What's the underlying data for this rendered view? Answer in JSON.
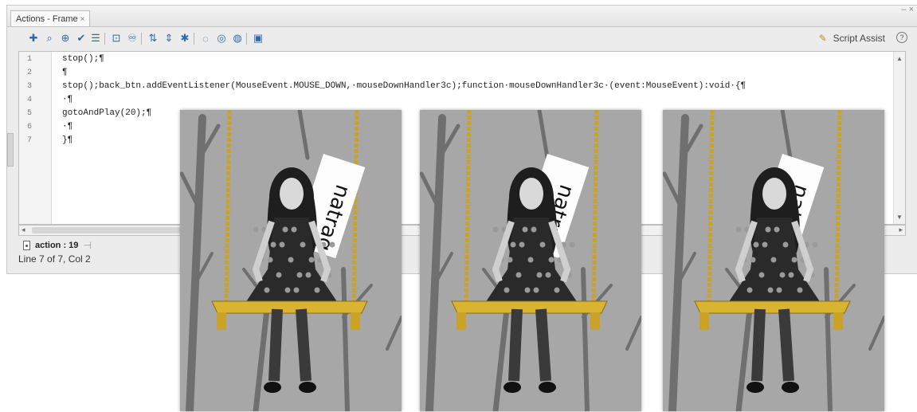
{
  "window": {
    "tab_title": "Actions - Frame",
    "tab_close": "×",
    "controls": "– ×"
  },
  "toolbar": {
    "icons": [
      "add-statement-icon",
      "find-icon",
      "target-path-icon",
      "check-syntax-icon",
      "auto-format-icon",
      "code-hint-icon",
      "debug-options-icon",
      "collapse-braces-icon",
      "collapse-selection-icon",
      "expand-all-icon",
      "apply-block-comment-icon",
      "apply-line-comment-icon",
      "remove-comment-icon",
      "show-hide-toolbox-icon"
    ],
    "script_assist_label": "Script Assist",
    "help_label": "?"
  },
  "editor": {
    "lines": [
      {
        "num": "1",
        "text": "stop();¶"
      },
      {
        "num": "2",
        "text": "¶"
      },
      {
        "num": "3",
        "text": "stop();back_btn.addEventListener(MouseEvent.MOUSE_DOWN,·mouseDownHandler3c);function·mouseDownHandler3c·(event:MouseEvent):void·{¶"
      },
      {
        "num": "4",
        "text": "·¶"
      },
      {
        "num": "5",
        "text": "gotoAndPlay(20);¶"
      },
      {
        "num": "6",
        "text": "·¶"
      },
      {
        "num": "7",
        "text": "}¶"
      }
    ]
  },
  "script_tab": {
    "label": "action : 19"
  },
  "status": {
    "text": "Line 7 of 7, Col 2"
  },
  "frames": [
    {
      "sign_text": "natrag",
      "sign_state": "hidden"
    },
    {
      "sign_text": "natrag",
      "sign_state": "partial"
    },
    {
      "sign_text": "natrag",
      "sign_state": "full"
    }
  ],
  "colors": {
    "rope": "#c9a227",
    "swing_seat": "#d9b431",
    "background_gray": "#a7a7a7",
    "keyword_blue": "#0000cc"
  }
}
